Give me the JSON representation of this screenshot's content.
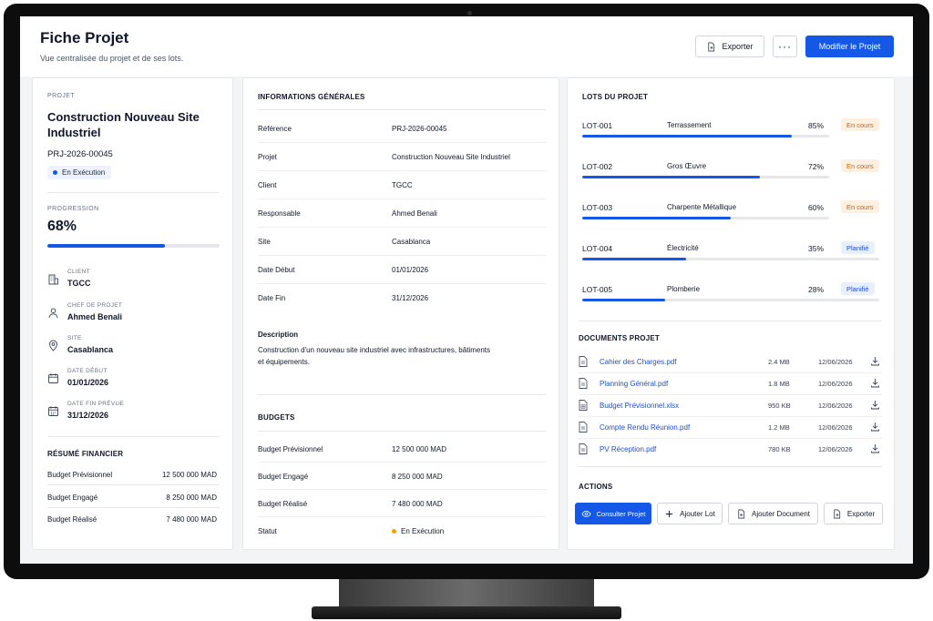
{
  "header": {
    "title": "Fiche Projet",
    "subtitle": "Vue centralisée du projet et de ses lots.",
    "export_label": "Exporter",
    "more_label": "···",
    "edit_label": "Modifier le Projet"
  },
  "summary": {
    "section_label": "PROJET",
    "project_name": "Construction Nouveau Site Industriel",
    "reference": "PRJ-2026-00045",
    "status": "En Exécution",
    "progress_label": "PROGRESSION",
    "progress_value": "68%",
    "progress_fraction": 0.68,
    "info": [
      {
        "label": "CLIENT",
        "value": "TGCC",
        "icon": "building-icon"
      },
      {
        "label": "CHEF DE PROJET",
        "value": "Ahmed Benali",
        "icon": "user-icon"
      },
      {
        "label": "SITE",
        "value": "Casablanca",
        "icon": "map-pin-icon"
      },
      {
        "label": "DATE DÉBUT",
        "value": "01/01/2026",
        "icon": "calendar-icon"
      },
      {
        "label": "DATE FIN PRÉVUE",
        "value": "31/12/2026",
        "icon": "calendar-clock-icon"
      }
    ],
    "finance_title": "RÉSUMÉ FINANCIER",
    "finance": [
      {
        "label": "Budget Prévisionnel",
        "value": "12 500 000 MAD"
      },
      {
        "label": "Budget Engagé",
        "value": "8 250 000 MAD"
      },
      {
        "label": "Budget Réalisé",
        "value": "7 480 000 MAD"
      }
    ]
  },
  "general": {
    "title": "INFORMATIONS GÉNÉRALES",
    "rows": [
      {
        "key": "Référence",
        "value": "PRJ-2026-00045"
      },
      {
        "key": "Projet",
        "value": "Construction Nouveau Site Industriel"
      },
      {
        "key": "Client",
        "value": "TGCC"
      },
      {
        "key": "Responsable",
        "value": "Ahmed Benali"
      },
      {
        "key": "Site",
        "value": "Casablanca"
      },
      {
        "key": "Date Début",
        "value": "01/01/2026"
      },
      {
        "key": "Date Fin",
        "value": "31/12/2026"
      }
    ],
    "description_title": "Description",
    "description_text": "Construction d'un nouveau site industriel avec infrastructures, bâtiments et équipements.",
    "budgets_title": "BUDGETS",
    "budgets": [
      {
        "key": "Budget Prévisionnel",
        "value": "12 500 000 MAD"
      },
      {
        "key": "Budget Engagé",
        "value": "8 250 000 MAD"
      },
      {
        "key": "Budget Réalisé",
        "value": "7 480 000 MAD"
      },
      {
        "key": "Statut",
        "value": "En Exécution"
      }
    ],
    "status_color": "#f59e0b"
  },
  "lots": {
    "title": "LOTS DU PROJET",
    "items": [
      {
        "code": "LOT-001",
        "name": "Terrassement",
        "percent": "85%",
        "fraction": 0.85,
        "status": "En cours",
        "status_type": "orange"
      },
      {
        "code": "LOT-002",
        "name": "Gros Œuvre",
        "percent": "72%",
        "fraction": 0.72,
        "status": "En cours",
        "status_type": "orange"
      },
      {
        "code": "LOT-003",
        "name": "Charpente Métallique",
        "percent": "60%",
        "fraction": 0.6,
        "status": "En cours",
        "status_type": "orange"
      },
      {
        "code": "LOT-004",
        "name": "Électricité",
        "percent": "35%",
        "fraction": 0.35,
        "status": "Planifié",
        "status_type": "blue"
      },
      {
        "code": "LOT-005",
        "name": "Plomberie",
        "percent": "28%",
        "fraction": 0.28,
        "status": "Planifié",
        "status_type": "blue"
      }
    ]
  },
  "documents": {
    "title": "DOCUMENTS PROJET",
    "items": [
      {
        "name": "Cahier des Charges.pdf",
        "size": "2.4 MB",
        "date": "12/06/2026"
      },
      {
        "name": "Planning Général.pdf",
        "size": "1.8 MB",
        "date": "12/06/2026"
      },
      {
        "name": "Budget Prévisionnel.xlsx",
        "size": "950 KB",
        "date": "12/06/2026"
      },
      {
        "name": "Compte Rendu Réunion.pdf",
        "size": "1.2 MB",
        "date": "12/06/2026"
      },
      {
        "name": "PV Réception.pdf",
        "size": "780 KB",
        "date": "12/06/2026"
      }
    ]
  },
  "actions": {
    "title": "ACTIONS",
    "view_label": "Consulter Projet",
    "add_lot_label": "Ajouter Lot",
    "add_doc_label": "Ajouter Document",
    "export_label": "Exporter"
  },
  "colors": {
    "primary": "#1558e8",
    "badge_orange_bg": "#fdf0e1",
    "badge_blue_bg": "#e8efff"
  }
}
